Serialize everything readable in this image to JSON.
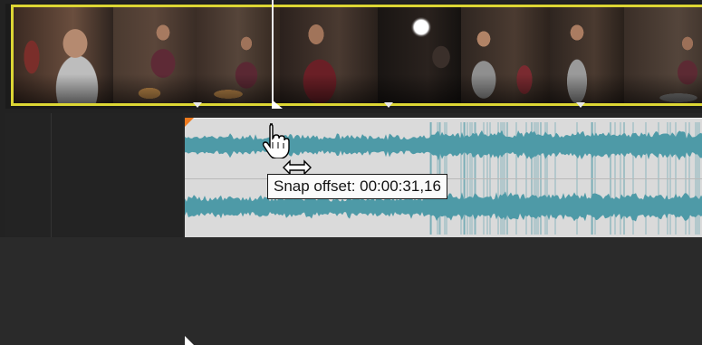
{
  "tooltip": {
    "label": "Snap offset",
    "value": "00:00:31,16",
    "text": "Snap offset: 00:00:31,16"
  },
  "icons": {
    "cursor": "hand-pointer-icon",
    "resize": "horizontal-resize-icon",
    "clip_marker": "clip-marker-triangle-icon",
    "fade_handle": "fade-handle-icon"
  },
  "colors": {
    "video_clip_border": "#dcd634",
    "waveform": "#4e9aa7",
    "audio_clip_bg": "#dadada",
    "fade_handle": "#ee7a1e",
    "selection_corner": "#3aa7e6",
    "track_bg": "#222222"
  }
}
